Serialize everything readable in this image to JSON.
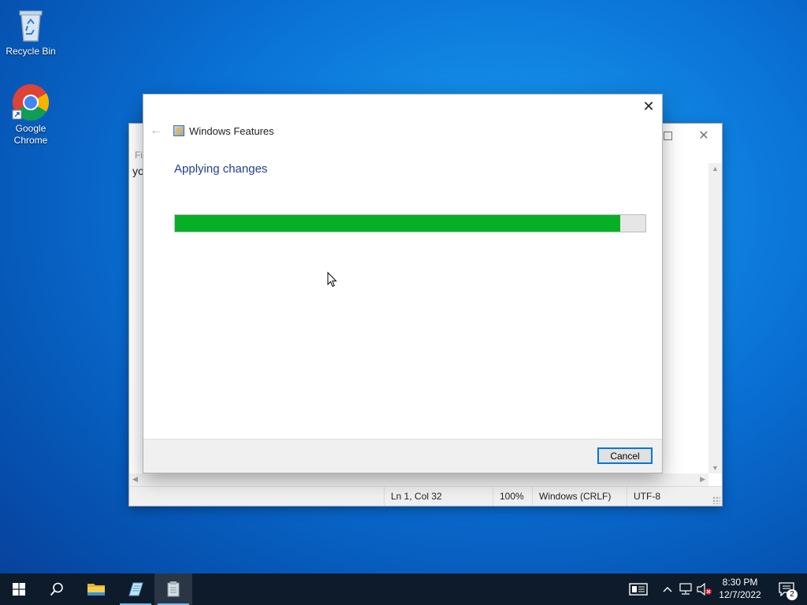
{
  "desktop": {
    "icons": [
      {
        "label": "Recycle Bin",
        "icon": "recycle-bin-icon"
      },
      {
        "label": "Google\nChrome",
        "icon": "chrome-icon"
      }
    ]
  },
  "notepad": {
    "menu_partial": "Fil",
    "text_partial": "yo",
    "status": {
      "position": "Ln 1, Col 32",
      "zoom": "100%",
      "line_ending": "Windows (CRLF)",
      "encoding": "UTF-8"
    }
  },
  "dialog": {
    "title": "Windows Features",
    "heading": "Applying changes",
    "progress_fraction": 0.947,
    "progress_color": "#06b025",
    "cancel_label": "Cancel"
  },
  "taskbar": {
    "time": "8:30 PM",
    "date": "12/7/2022",
    "notification_count": "2"
  }
}
